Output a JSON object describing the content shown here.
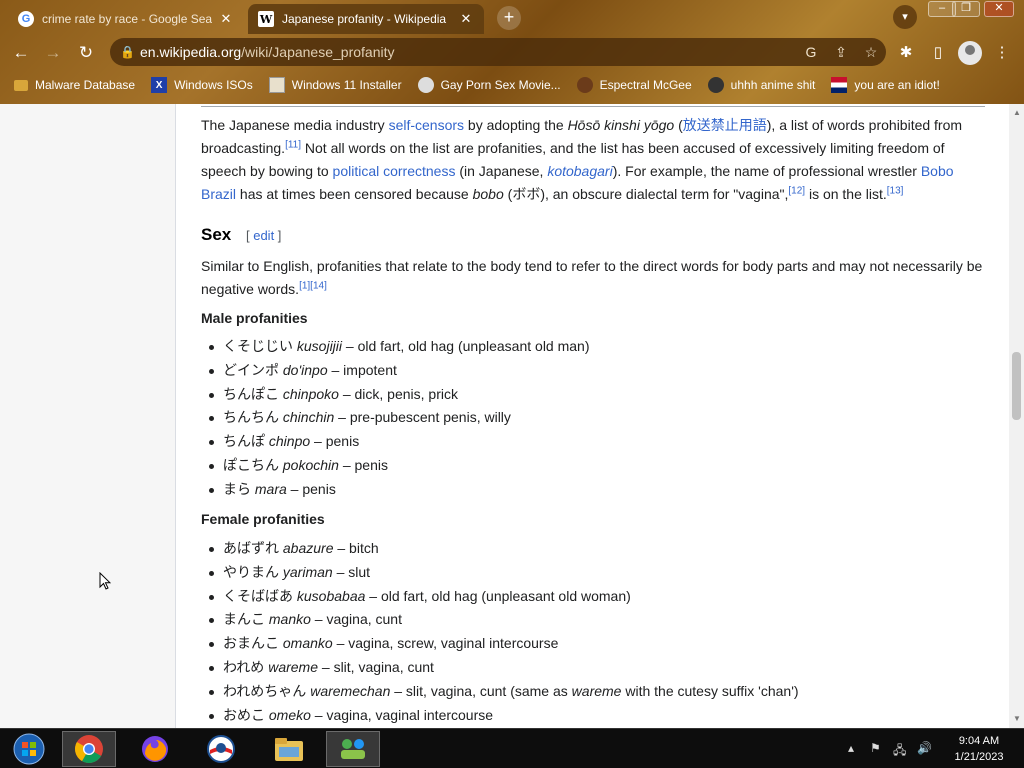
{
  "browser": {
    "tabs": [
      {
        "title": "crime rate by race - Google Searc",
        "favicon": "google-icon",
        "active": false
      },
      {
        "title": "Japanese profanity - Wikipedia",
        "favicon": "wikipedia-icon",
        "active": true
      }
    ],
    "new_tab": "+",
    "close_glyph": "✕",
    "url_host": "en.wikipedia.org",
    "url_path": "/wiki/Japanese_profanity",
    "bookmarks": [
      {
        "label": "Malware Database",
        "icon": "folder-icon"
      },
      {
        "label": "Windows ISOs",
        "icon": "x-icon"
      },
      {
        "label": "Windows 11 Installer",
        "icon": "page-icon"
      },
      {
        "label": "Gay Porn Sex Movie...",
        "icon": "site-icon"
      },
      {
        "label": "Espectral McGee",
        "icon": "site-icon"
      },
      {
        "label": "uhhh anime shit",
        "icon": "site-icon"
      },
      {
        "label": "you are an idiot!",
        "icon": "flag-icon"
      }
    ]
  },
  "article": {
    "intro": {
      "t1": "The Japanese media industry ",
      "l1": "self-censors",
      "t2": " by adopting the ",
      "i1": "Hōsō kinshi yōgo",
      "t3": " (",
      "l2": "放送禁止用語",
      "t4": "), a list of words prohibited from broadcasting.",
      "s1": "[11]",
      "t5": " Not all words on the list are profanities, and the list has been accused of excessively limiting freedom of speech by bowing to ",
      "l3": "political correctness",
      "t6": " (in Japanese, ",
      "l4": "kotobagari",
      "t7": "). For example, the name of professional wrestler ",
      "l5": "Bobo Brazil",
      "t8": " has at times been censored because ",
      "i2": "bobo",
      "t9": " (ボボ), an obscure dialectal term for \"vagina\",",
      "s2": "[12]",
      "t10": " is on the list.",
      "s3": "[13]"
    },
    "sex_heading": "Sex",
    "edit_open": "[ ",
    "edit_label": "edit",
    "edit_close": " ]",
    "sex_para": "Similar to English, profanities that relate to the body tend to refer to the direct words for body parts and may not necessarily be negative words.",
    "sex_refs": "[1][14]",
    "male_heading": "Male profanities",
    "male": [
      {
        "jp": "くそじじい",
        "romaji": "kusojijii",
        "meaning": " – old fart, old hag (unpleasant old man)"
      },
      {
        "jp": "どインポ",
        "romaji": "do'inpo",
        "meaning": " – impotent"
      },
      {
        "jp": "ちんぽこ",
        "romaji": "chinpoko",
        "meaning": " – dick, penis, prick"
      },
      {
        "jp": "ちんちん",
        "romaji": "chinchin",
        "meaning": " – pre-pubescent penis, willy"
      },
      {
        "jp": "ちんぽ",
        "romaji": "chinpo",
        "meaning": " – penis"
      },
      {
        "jp": "ぽこちん",
        "romaji": "pokochin",
        "meaning": " – penis"
      },
      {
        "jp": "まら",
        "romaji": "mara",
        "meaning": " – penis"
      }
    ],
    "female_heading": "Female profanities",
    "female": [
      {
        "jp": "あばずれ",
        "romaji": "abazure",
        "meaning": " – bitch"
      },
      {
        "jp": "やりまん",
        "romaji": "yariman",
        "meaning": " – slut"
      },
      {
        "jp": "くそばばあ",
        "romaji": "kusobabaa",
        "meaning": " – old fart, old hag (unpleasant old woman)"
      },
      {
        "jp": "まんこ",
        "romaji": "manko",
        "meaning": " – vagina, cunt"
      },
      {
        "jp": "おまんこ",
        "romaji": "omanko",
        "meaning": " – vagina, screw, vaginal intercourse"
      },
      {
        "jp": "われめ",
        "romaji": "wareme",
        "meaning": " – slit, vagina, cunt"
      },
      {
        "jp": "われめちゃん",
        "romaji": "waremechan",
        "meaning": " – slit, vagina, cunt (same as ",
        "romaji2": "wareme",
        "meaning2": " with the cutesy suffix 'chan')"
      },
      {
        "jp": "おめこ",
        "romaji": "omeko",
        "meaning": " – vagina, vaginal intercourse"
      }
    ]
  },
  "taskbar": {
    "time": "9:04 AM",
    "date": "1/21/2023",
    "apps": [
      "start-orb-icon",
      "chrome-icon",
      "firefox-icon",
      "obama-logo-icon",
      "file-explorer-icon",
      "network-people-icon"
    ]
  },
  "colors": {
    "link": "#3366cc",
    "chrome_brown": "#8a5a18",
    "taskbar": "#0d0d0d"
  }
}
